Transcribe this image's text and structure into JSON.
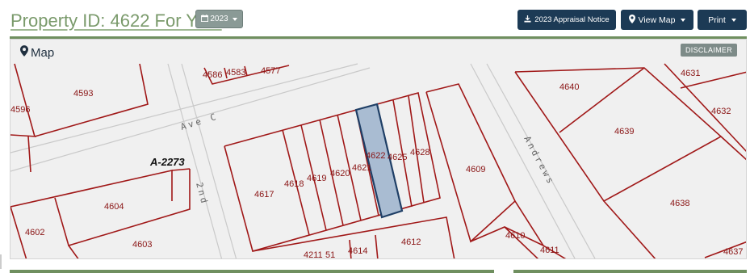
{
  "header": {
    "title": "Property ID: 4622 For Year",
    "year_label": "2023",
    "appraisal_notice_label": "2023 Appraisal Notice",
    "view_map_label": "View Map",
    "print_label": "Print"
  },
  "map_panel": {
    "title": "Map",
    "disclaimer_label": "DISCLAIMER",
    "selected_parcel": "4622",
    "parcel_labels": [
      "4593",
      "4596",
      "4586",
      "4583",
      "4577",
      "4604",
      "4602",
      "4603",
      "4617",
      "4618",
      "4619",
      "4620",
      "4621",
      "4622",
      "4625",
      "4628",
      "4609",
      "4612",
      "4614",
      "4211",
      "51",
      "4610",
      "4611",
      "4640",
      "4639",
      "4638",
      "4631",
      "4632",
      "4637"
    ],
    "subdivision_label": "A-2273",
    "street_labels": [
      "Ave C",
      "2nd",
      "Andrews"
    ]
  },
  "colors": {
    "parcel_line": "#a01818",
    "selected_fill": "#a9bcd2",
    "selected_stroke": "#1f3f66",
    "nav_button": "#1c3a55",
    "accent_green": "#6f8f5f"
  }
}
